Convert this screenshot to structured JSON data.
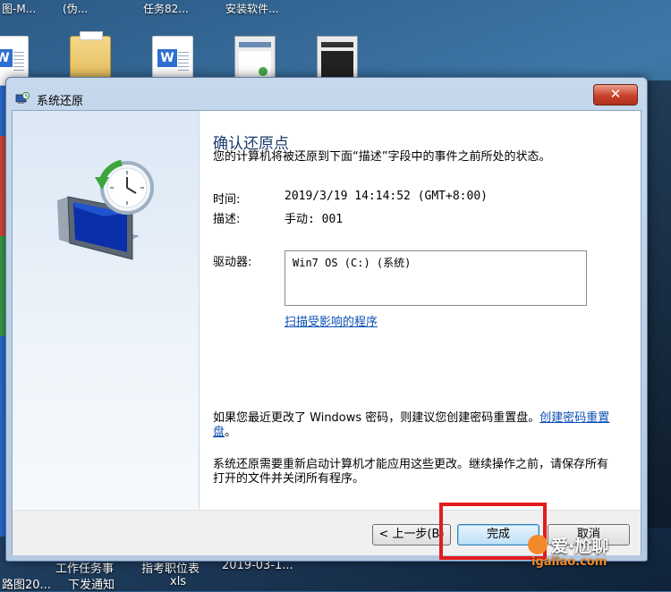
{
  "desktop": {
    "top_labels": [
      "图-M...",
      "(伪...",
      "任务82...",
      "安装软件..."
    ],
    "taskbar_labels": [
      "路图20...",
      "下发通知",
      "xls",
      "工作任务事",
      "指考职位表",
      "2019-03-1..."
    ]
  },
  "window": {
    "title": "系统还原",
    "close_label": "✕"
  },
  "content": {
    "heading": "确认还原点",
    "description": "您的计算机将被还原到下面“描述”字段中的事件之前所处的状态。",
    "time_label": "时间:",
    "time_value": "2019/3/19 14:14:52 (GMT+8:00)",
    "desc_label": "描述:",
    "desc_value": "手动: 001",
    "drive_label": "驱动器:",
    "drive_value": "Win7 OS (C:) (系统)",
    "scan_link": "扫描受影响的程序",
    "password_text": "如果您最近更改了 Windows 密码，则建议您创建密码重置盘。",
    "password_link": "创建密码重置盘",
    "password_suffix": "。",
    "restart_text": "系统还原需要重新启动计算机才能应用这些更改。继续操作之前，请保存所有打开的文件并关闭所有程序。"
  },
  "footer": {
    "back_label": "< 上一步(B)",
    "finish_label": "完成",
    "cancel_label": "取消"
  },
  "annotation": {
    "highlight_color": "#e21d1d"
  },
  "watermark": {
    "top": "爱·尬聊",
    "bottom": "igaliao.com"
  }
}
